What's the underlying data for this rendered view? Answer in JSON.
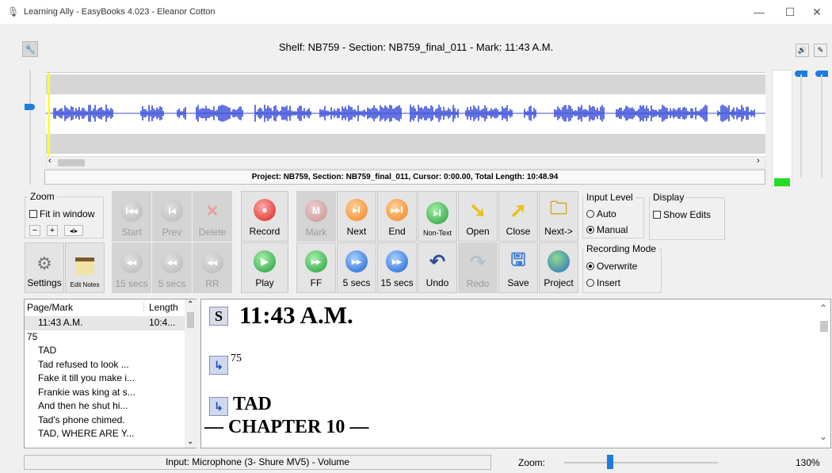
{
  "window": {
    "title": "Learning Ally - EasyBooks 4.023 - Eleanor Cotton",
    "minimize": "—",
    "maximize": "☐",
    "close": "✕"
  },
  "header": {
    "shelf_line": "Shelf: NB759 - Section: NB759_final_011 - Mark: 11:43 A.M."
  },
  "waveform": {
    "project_line": "Project: NB759, Section: NB759_final_011, Cursor: 0:00.00, Total Length: 10:48.94",
    "scroll_left": "‹",
    "scroll_right": "›",
    "accent": "#3b4fd8",
    "level_color": "#22dd22"
  },
  "zoom_group": {
    "legend": "Zoom",
    "fit_label": "Fit in window",
    "minus": "−",
    "plus": "+",
    "narrow": "◂I▸"
  },
  "toolbar_top": [
    {
      "label": "Start",
      "state": "disabled",
      "icon": "rewind-start-icon"
    },
    {
      "label": "Prev",
      "state": "disabled",
      "icon": "previous-icon"
    },
    {
      "label": "Delete",
      "state": "disabled",
      "icon": "delete-icon"
    },
    {
      "label": "Record",
      "state": "enabled",
      "icon": "record-icon"
    },
    {
      "label": "Mark",
      "state": "disabled",
      "icon": "mark-icon"
    },
    {
      "label": "Next",
      "state": "enabled",
      "icon": "next-icon"
    },
    {
      "label": "End",
      "state": "enabled",
      "icon": "end-icon"
    },
    {
      "label": "Non-Text",
      "state": "enabled",
      "icon": "non-text-icon"
    },
    {
      "label": "Open",
      "state": "enabled",
      "icon": "open-icon"
    },
    {
      "label": "Close",
      "state": "enabled",
      "icon": "close-book-icon"
    },
    {
      "label": "Next->",
      "state": "enabled",
      "icon": "next-folder-icon"
    }
  ],
  "toolbar_bottom": [
    {
      "label": "Settings",
      "state": "enabled",
      "icon": "gear-icon"
    },
    {
      "label": "Edit Notes",
      "state": "enabled",
      "icon": "notes-icon"
    },
    {
      "label": "15 secs",
      "state": "disabled",
      "icon": "back-15-icon"
    },
    {
      "label": "5 secs",
      "state": "disabled",
      "icon": "back-5-icon"
    },
    {
      "label": "RR",
      "state": "disabled",
      "icon": "rr-icon"
    },
    {
      "label": "Play",
      "state": "enabled",
      "icon": "play-icon"
    },
    {
      "label": "FF",
      "state": "enabled",
      "icon": "ff-icon"
    },
    {
      "label": "5 secs",
      "state": "enabled",
      "icon": "forward-5-icon"
    },
    {
      "label": "15 secs",
      "state": "enabled",
      "icon": "forward-15-icon"
    },
    {
      "label": "Undo",
      "state": "enabled",
      "icon": "undo-icon"
    },
    {
      "label": "Redo",
      "state": "disabled",
      "icon": "redo-icon"
    },
    {
      "label": "Save",
      "state": "enabled",
      "icon": "save-icon"
    },
    {
      "label": "Project",
      "state": "enabled",
      "icon": "globe-icon"
    }
  ],
  "input_level": {
    "legend": "Input Level",
    "auto": "Auto",
    "manual": "Manual",
    "selected": "Manual"
  },
  "display": {
    "legend": "Display",
    "show_edits": "Show Edits"
  },
  "recording_mode": {
    "legend": "Recording Mode",
    "overwrite": "Overwrite",
    "insert": "Insert",
    "selected": "Overwrite"
  },
  "list": {
    "col_page": "Page/Mark",
    "col_length": "Length",
    "rows": [
      {
        "text": "11:43 A.M.",
        "length": "10:4...",
        "indent": true,
        "selected": true
      },
      {
        "text": "75",
        "length": "",
        "indent": false,
        "selected": false
      },
      {
        "text": "TAD",
        "length": "",
        "indent": true,
        "selected": false
      },
      {
        "text": "Tad refused to look ...",
        "length": "",
        "indent": true,
        "selected": false
      },
      {
        "text": "Fake it till you make i...",
        "length": "",
        "indent": true,
        "selected": false
      },
      {
        "text": "Frankie was king at s...",
        "length": "",
        "indent": true,
        "selected": false
      },
      {
        "text": "And then he shut hi...",
        "length": "",
        "indent": true,
        "selected": false
      },
      {
        "text": "Tad's phone chimed.",
        "length": "",
        "indent": true,
        "selected": false
      },
      {
        "text": "TAD, WHERE ARE Y...",
        "length": "",
        "indent": true,
        "selected": false
      }
    ]
  },
  "document": {
    "section_badge": "S",
    "heading": "11:43 A.M.",
    "page_number": "75",
    "tad_heading": "TAD",
    "chapter": "— CHAPTER 10 —"
  },
  "status": {
    "input_text": "Input: Microphone (3- Shure MV5) - Volume",
    "zoom_label": "Zoom:",
    "zoom_percent": "130%",
    "zoom_level": 0.3
  }
}
